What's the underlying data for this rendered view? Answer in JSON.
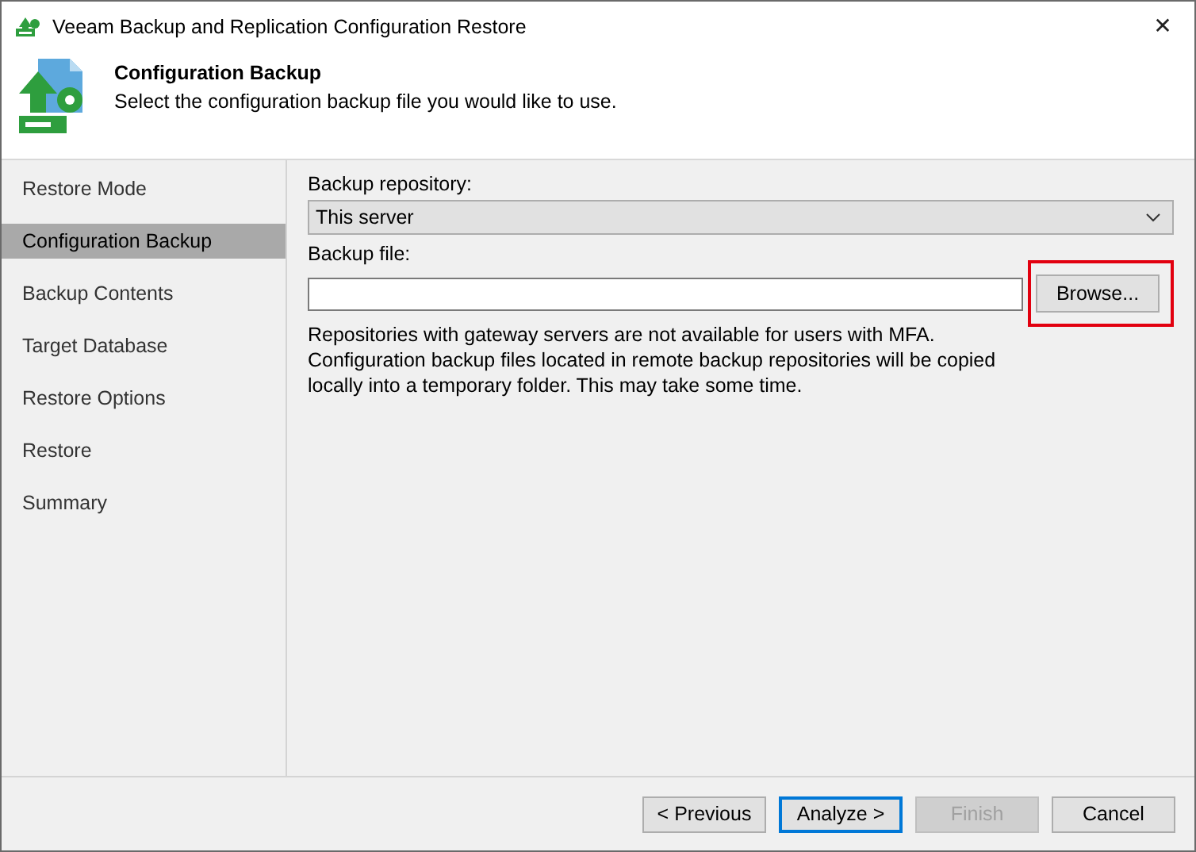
{
  "window": {
    "title": "Veeam Backup and Replication Configuration Restore",
    "close": "✕"
  },
  "header": {
    "title": "Configuration Backup",
    "subtitle": "Select the configuration backup file you would like to use."
  },
  "sidebar": {
    "items": [
      {
        "label": "Restore Mode",
        "selected": false
      },
      {
        "label": "Configuration Backup",
        "selected": true
      },
      {
        "label": "Backup Contents",
        "selected": false
      },
      {
        "label": "Target Database",
        "selected": false
      },
      {
        "label": "Restore Options",
        "selected": false
      },
      {
        "label": "Restore",
        "selected": false
      },
      {
        "label": "Summary",
        "selected": false
      }
    ]
  },
  "form": {
    "repository_label": "Backup repository:",
    "repository_value": "This server",
    "file_label": "Backup file:",
    "browse": {
      "label": "Browse...",
      "highlighted": true
    },
    "note": "Repositories with gateway servers are not available for users with MFA. Configuration backup files located in remote backup repositories will be copied locally into a temporary folder. This may take some time."
  },
  "buttons": [
    {
      "label": "< Previous",
      "disabled": false,
      "default": false
    },
    {
      "label": "Analyze >",
      "disabled": false,
      "default": true
    },
    {
      "label": "Finish",
      "disabled": true,
      "default": false
    },
    {
      "label": "Cancel",
      "disabled": false,
      "default": false
    }
  ]
}
